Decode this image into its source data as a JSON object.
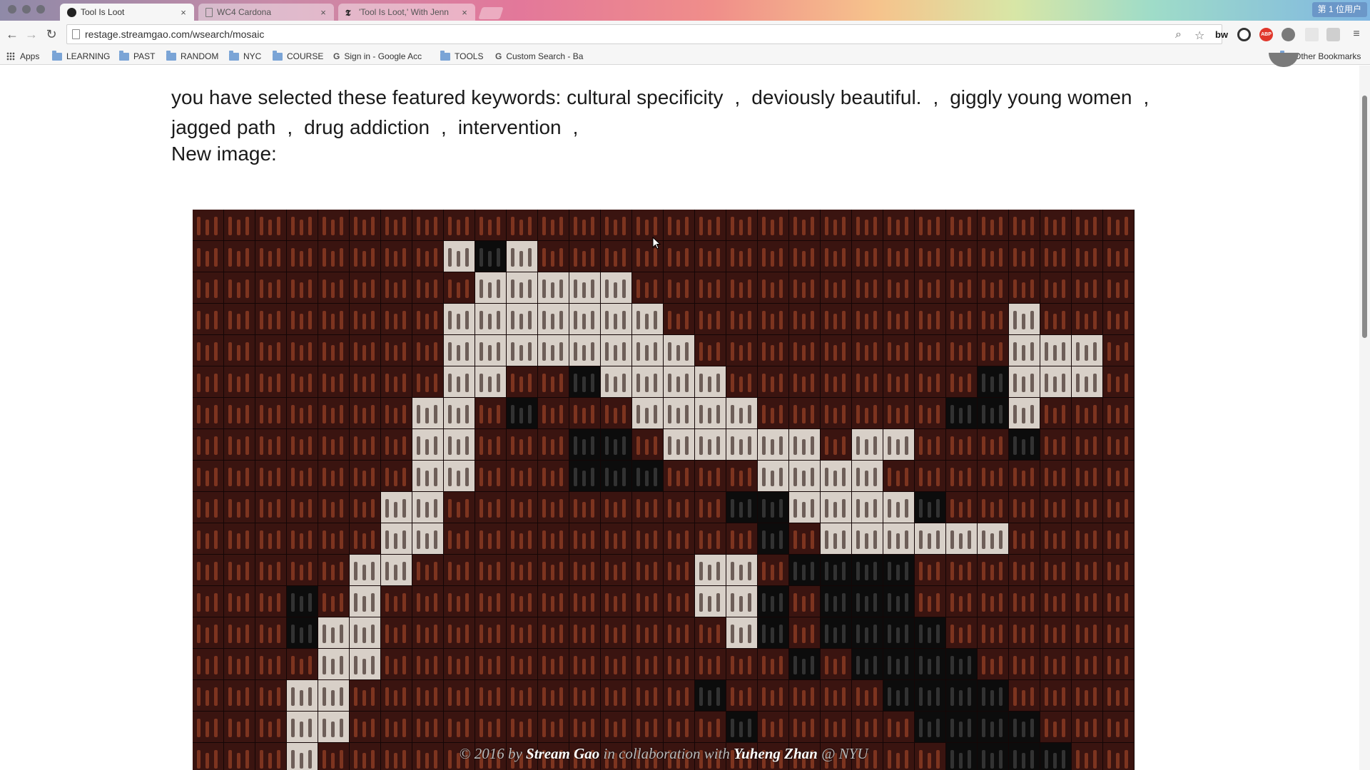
{
  "browser": {
    "tabs": [
      {
        "label": "Tool Is Loot",
        "active": true,
        "icon": "favicon-stream-icon"
      },
      {
        "label": "WC4 Cardona",
        "active": false,
        "icon": "page-icon"
      },
      {
        "label": "'Tool Is Loot,' With Jenn",
        "active": false,
        "icon": "nyt-icon"
      }
    ],
    "user_badge": "第 1 位用户",
    "url": "restage.streamgao.com/wsearch/mosaic",
    "bookmarks": [
      {
        "label": "Apps",
        "icon": "apps-grid-icon"
      },
      {
        "label": "LEARNING",
        "icon": "folder-icon"
      },
      {
        "label": "PAST",
        "icon": "folder-icon"
      },
      {
        "label": "RANDOM",
        "icon": "folder-icon"
      },
      {
        "label": "NYC",
        "icon": "folder-icon"
      },
      {
        "label": "COURSE",
        "icon": "folder-icon"
      },
      {
        "label": "Sign in - Google Acc",
        "icon": "google-icon"
      },
      {
        "label": "TOOLS",
        "icon": "folder-icon"
      },
      {
        "label": "Custom Search - Ba",
        "icon": "google-icon"
      }
    ],
    "other_bookmarks": "Other Bookmarks",
    "extensions": [
      "bw",
      "ABP"
    ]
  },
  "content": {
    "intro": "you have selected these featured keywords:",
    "keywords": [
      "cultural specificity",
      "deviously beautiful.",
      "giggly young women",
      "jagged path",
      "drug addiction",
      "intervention"
    ],
    "separator": ",",
    "new_image_label": "New image:",
    "credit": {
      "prefix": "© 2016 by",
      "author": "Stream Gao",
      "middle": "in collaboration with",
      "collaborator": "Yuheng Zhan",
      "suffix": "@ NYU"
    }
  },
  "colors": {
    "tile_dark": "#3a1410",
    "tile_warm": "#8a3a22",
    "tile_light": "#d8d0c8",
    "tile_black": "#0c0c0c"
  }
}
